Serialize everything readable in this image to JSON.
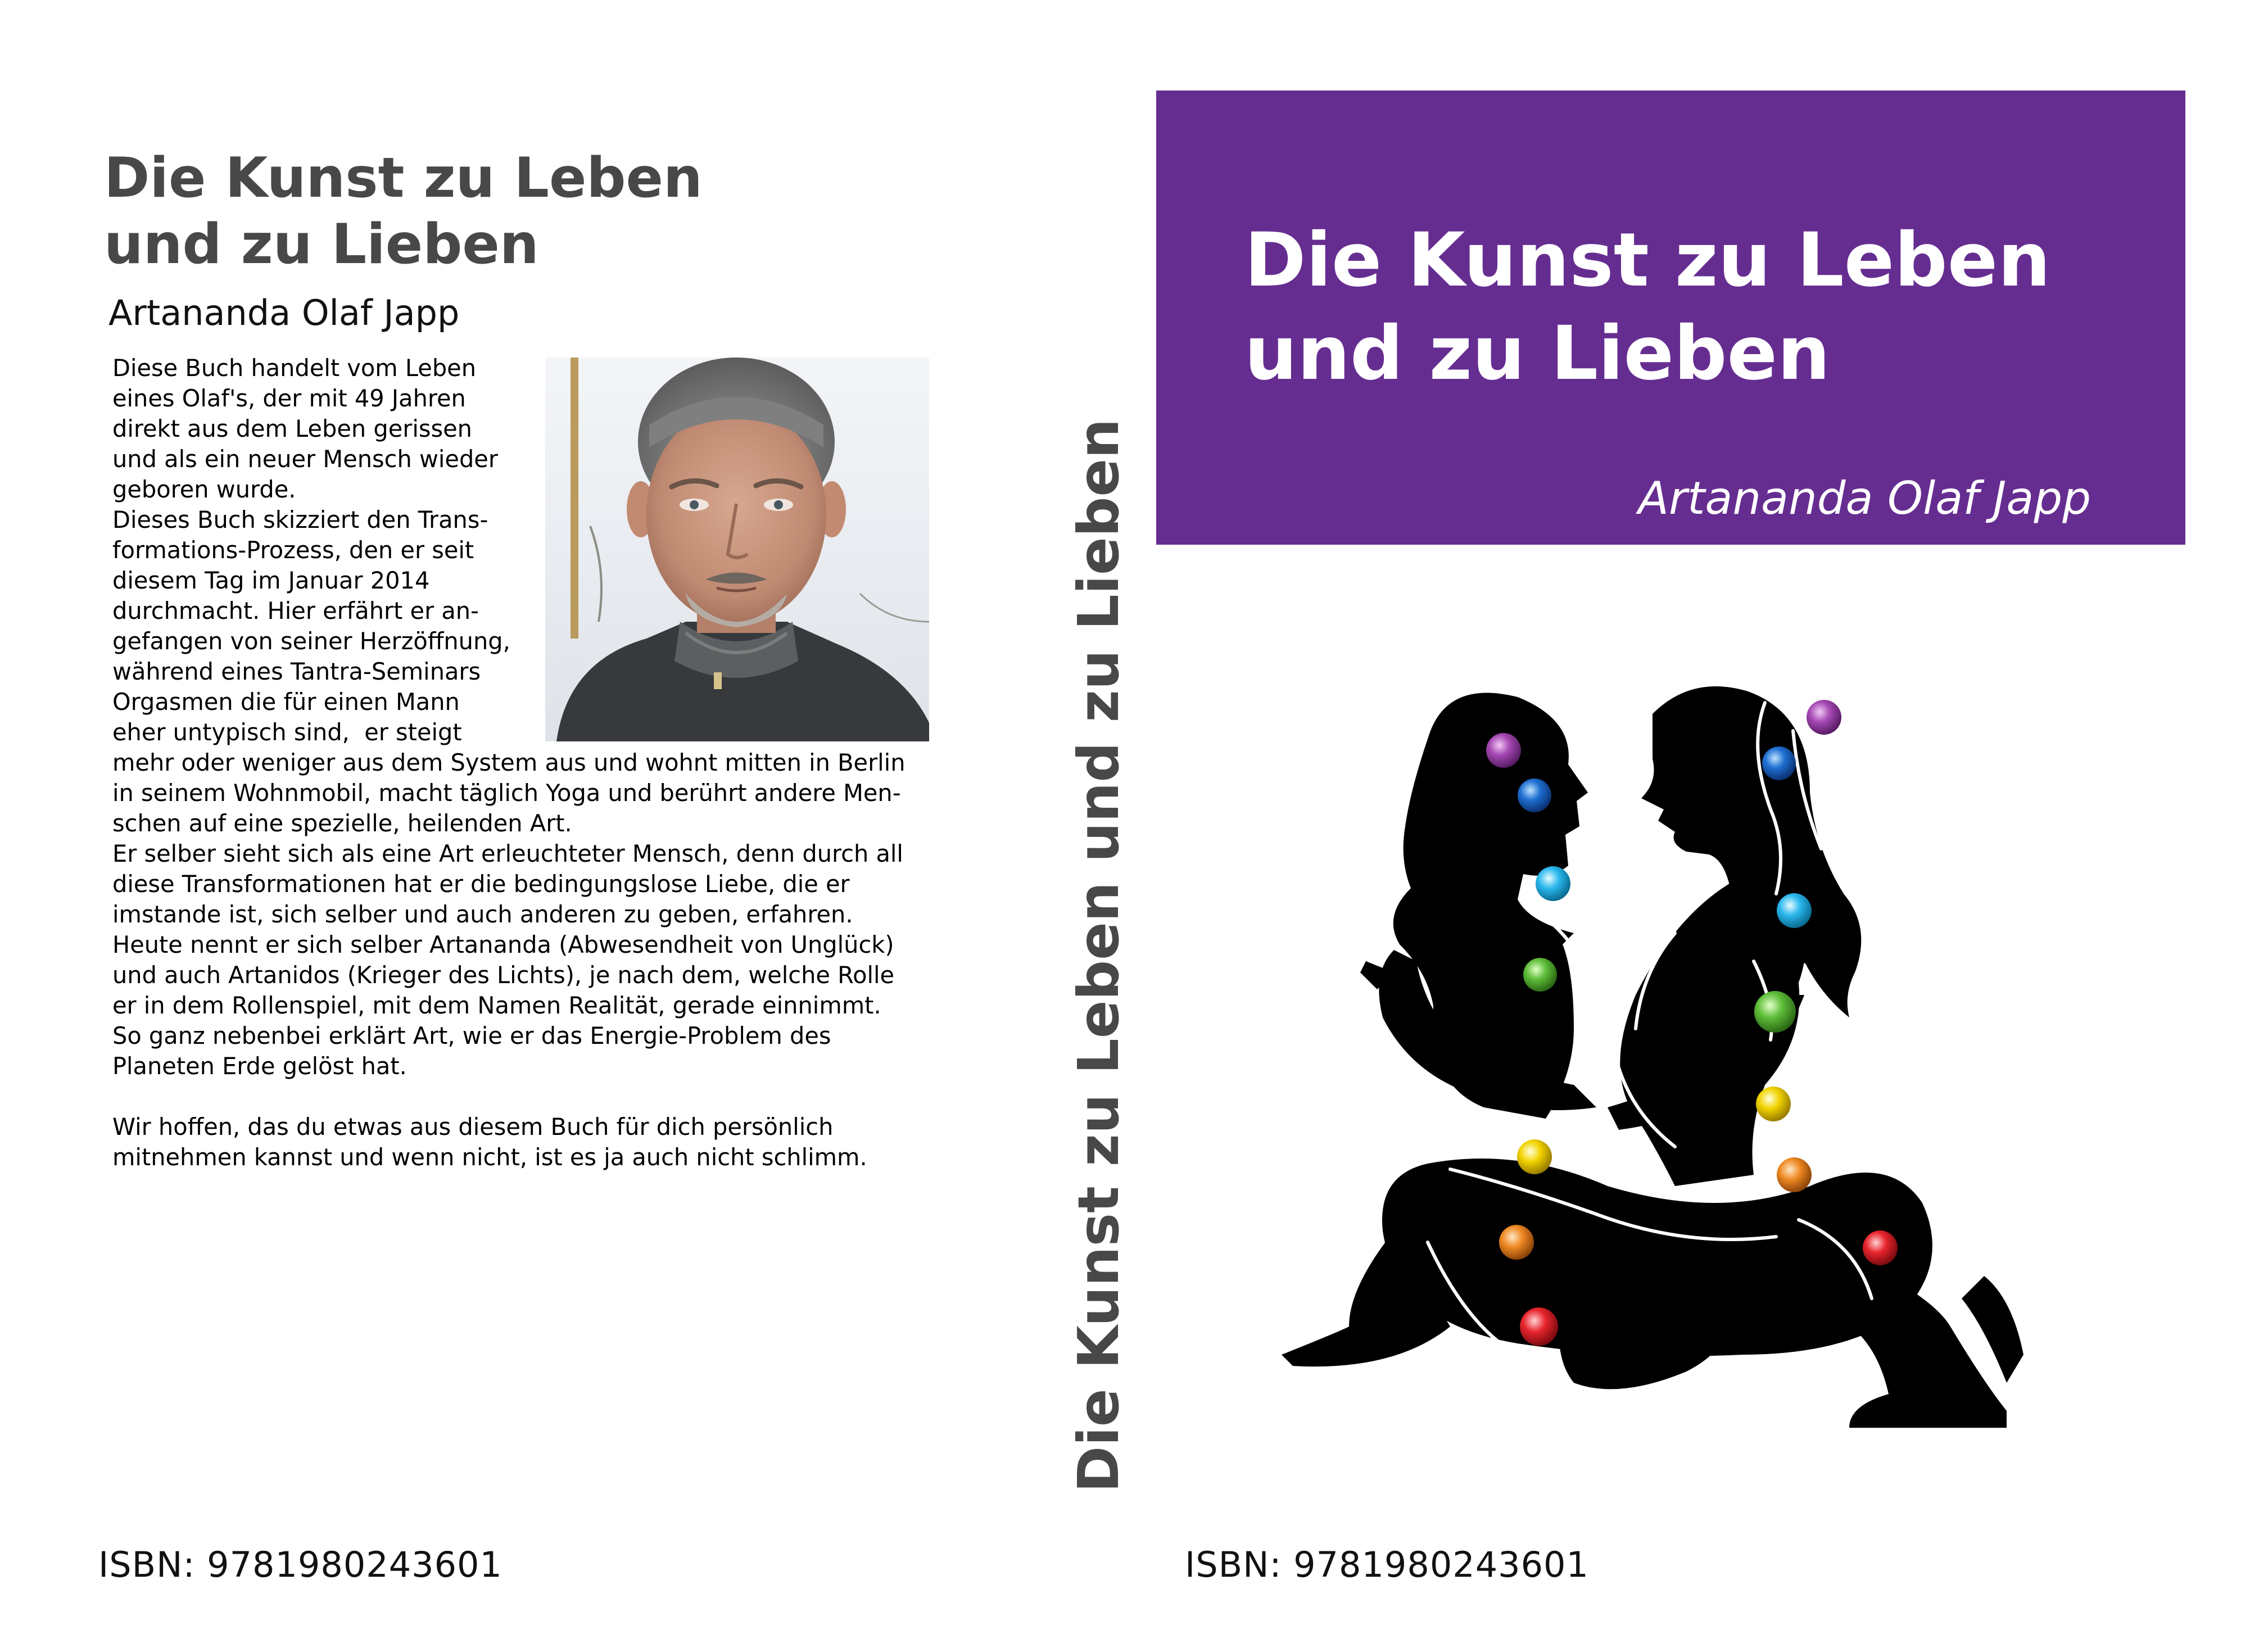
{
  "book": {
    "title_line1": "Die Kunst zu Leben",
    "title_line2": "und zu Lieben",
    "spine_title": "Die Kunst zu Leben und zu Lieben",
    "author": "Artananda Olaf Japp",
    "isbn": "ISBN: 9781980243601",
    "banner_color": "#662d91"
  },
  "back_cover": {
    "blurb_lines": [
      "Diese Buch handelt vom Leben",
      "eines Olaf's, der mit 49 Jahren",
      "direkt aus dem Leben gerissen",
      "und als ein neuer Mensch wieder",
      "geboren wurde.",
      "Dieses Buch skizziert den Trans-",
      "formations-Prozess, den er seit",
      "diesem Tag im Januar 2014",
      "durchmacht. Hier erfährt er an-",
      "gefangen von seiner Herzöffnung,",
      "während eines Tantra-Seminars",
      "Orgasmen die für einen Mann",
      "eher untypisch sind,  er steigt",
      "mehr oder weniger aus dem System aus und wohnt mitten in Berlin",
      "in seinem Wohnmobil, macht täglich Yoga und berührt andere Men-",
      "schen auf eine spezielle, heilenden Art.",
      "Er selber sieht sich als eine Art erleuchteter Mensch, denn durch all",
      "diese Transformationen hat er die bedingungslose Liebe, die er",
      "imstande ist, sich selber und auch anderen zu geben, erfahren.",
      "Heute nennt er sich selber Artananda (Abwesendheit von Unglück)",
      "und auch Artanidos (Krieger des Lichts), je nach dem, welche Rolle",
      "er in dem Rollenspiel, mit dem Namen Realität, gerade einnimmt.",
      "So ganz nebenbei erklärt Art, wie er das Energie-Problem des",
      "Planeten Erde gelöst hat."
    ],
    "closing_lines": [
      "Wir hoffen, das du etwas aus diesem Buch für dich persönlich",
      "mitnehmen kannst und wenn nicht, ist es ja auch nicht schlimm."
    ],
    "photo_icon": "author-portrait"
  },
  "front_cover": {
    "illustration_icon": "embracing-couple-chakra-silhouette",
    "chakra_colors": [
      "#9b3fa8",
      "#1f6fd1",
      "#2bb8ee",
      "#5fbf3a",
      "#f2d400",
      "#f08a24",
      "#e8252d"
    ]
  }
}
